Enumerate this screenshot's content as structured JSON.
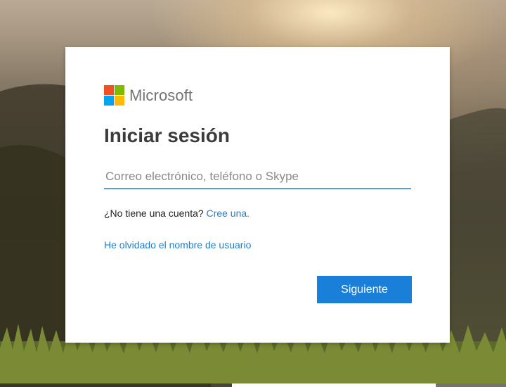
{
  "brand": {
    "name": "Microsoft",
    "colors": {
      "red": "#f25022",
      "green": "#7fba00",
      "blue": "#00a4ef",
      "yellow": "#ffb900"
    }
  },
  "signin": {
    "title": "Iniciar sesión",
    "email_placeholder": "Correo electrónico, teléfono o Skype",
    "email_value": "",
    "no_account_text": "¿No tiene una cuenta?",
    "create_link": "Cree una.",
    "forgot_username_link": "He olvidado el nombre de usuario",
    "next_button": "Siguiente"
  },
  "theme": {
    "accent": "#1a7fd9",
    "link": "#1e7fd0"
  }
}
